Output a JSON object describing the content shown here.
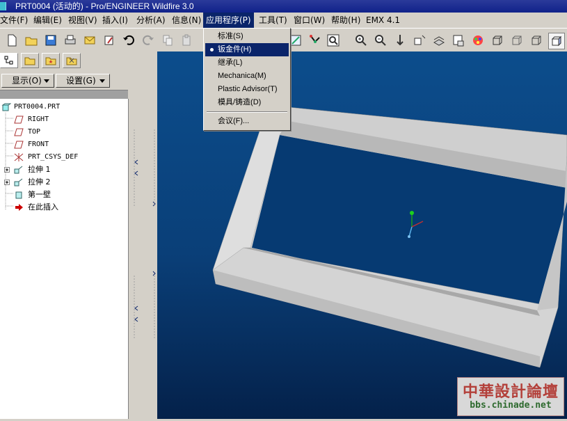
{
  "window": {
    "title": "PRT0004 (活动的) - Pro/ENGINEER Wildfire 3.0"
  },
  "menubar": [
    {
      "label": "文件(F)"
    },
    {
      "label": "编辑(E)"
    },
    {
      "label": "视图(V)"
    },
    {
      "label": "插入(I)"
    },
    {
      "label": "分析(A)"
    },
    {
      "label": "信息(N)"
    },
    {
      "label": "应用程序(P)"
    },
    {
      "label": "工具(T)"
    },
    {
      "label": "窗口(W)"
    },
    {
      "label": "帮助(H)"
    },
    {
      "label": "EMX 4.1"
    }
  ],
  "app_menu": {
    "items": [
      {
        "label": "标准(S)"
      },
      {
        "label": "钣金件(H)",
        "selected": true
      },
      {
        "label": "继承(L)"
      },
      {
        "label": "Mechanica(M)"
      },
      {
        "label": "Plastic Advisor(T)"
      },
      {
        "label": "模具/铸造(D)"
      },
      {
        "label": "会议(F)..."
      }
    ]
  },
  "panel": {
    "show_button": "显示(O)",
    "settings_button": "设置(G)"
  },
  "model_tree": [
    {
      "label": "PRT0004.PRT",
      "icon": "part-icon"
    },
    {
      "label": "RIGHT",
      "icon": "datum-plane-icon"
    },
    {
      "label": "TOP",
      "icon": "datum-plane-icon"
    },
    {
      "label": "FRONT",
      "icon": "datum-plane-icon"
    },
    {
      "label": "PRT_CSYS_DEF",
      "icon": "csys-icon"
    },
    {
      "label": "拉伸 1",
      "icon": "extrude-icon"
    },
    {
      "label": "拉伸 2",
      "icon": "extrude-icon"
    },
    {
      "label": "第一壁",
      "icon": "wall-icon"
    },
    {
      "label": "在此插入",
      "icon": "insert-here-arrow-icon"
    }
  ],
  "watermark": {
    "line1": "中華設計論壇",
    "line2": "bbs.chinade.net"
  },
  "colors": {
    "selection": "#0a246a",
    "viewport_top": "#0c4d8c",
    "viewport_bottom": "#04214a",
    "model_frame": "#d8d8d8"
  }
}
